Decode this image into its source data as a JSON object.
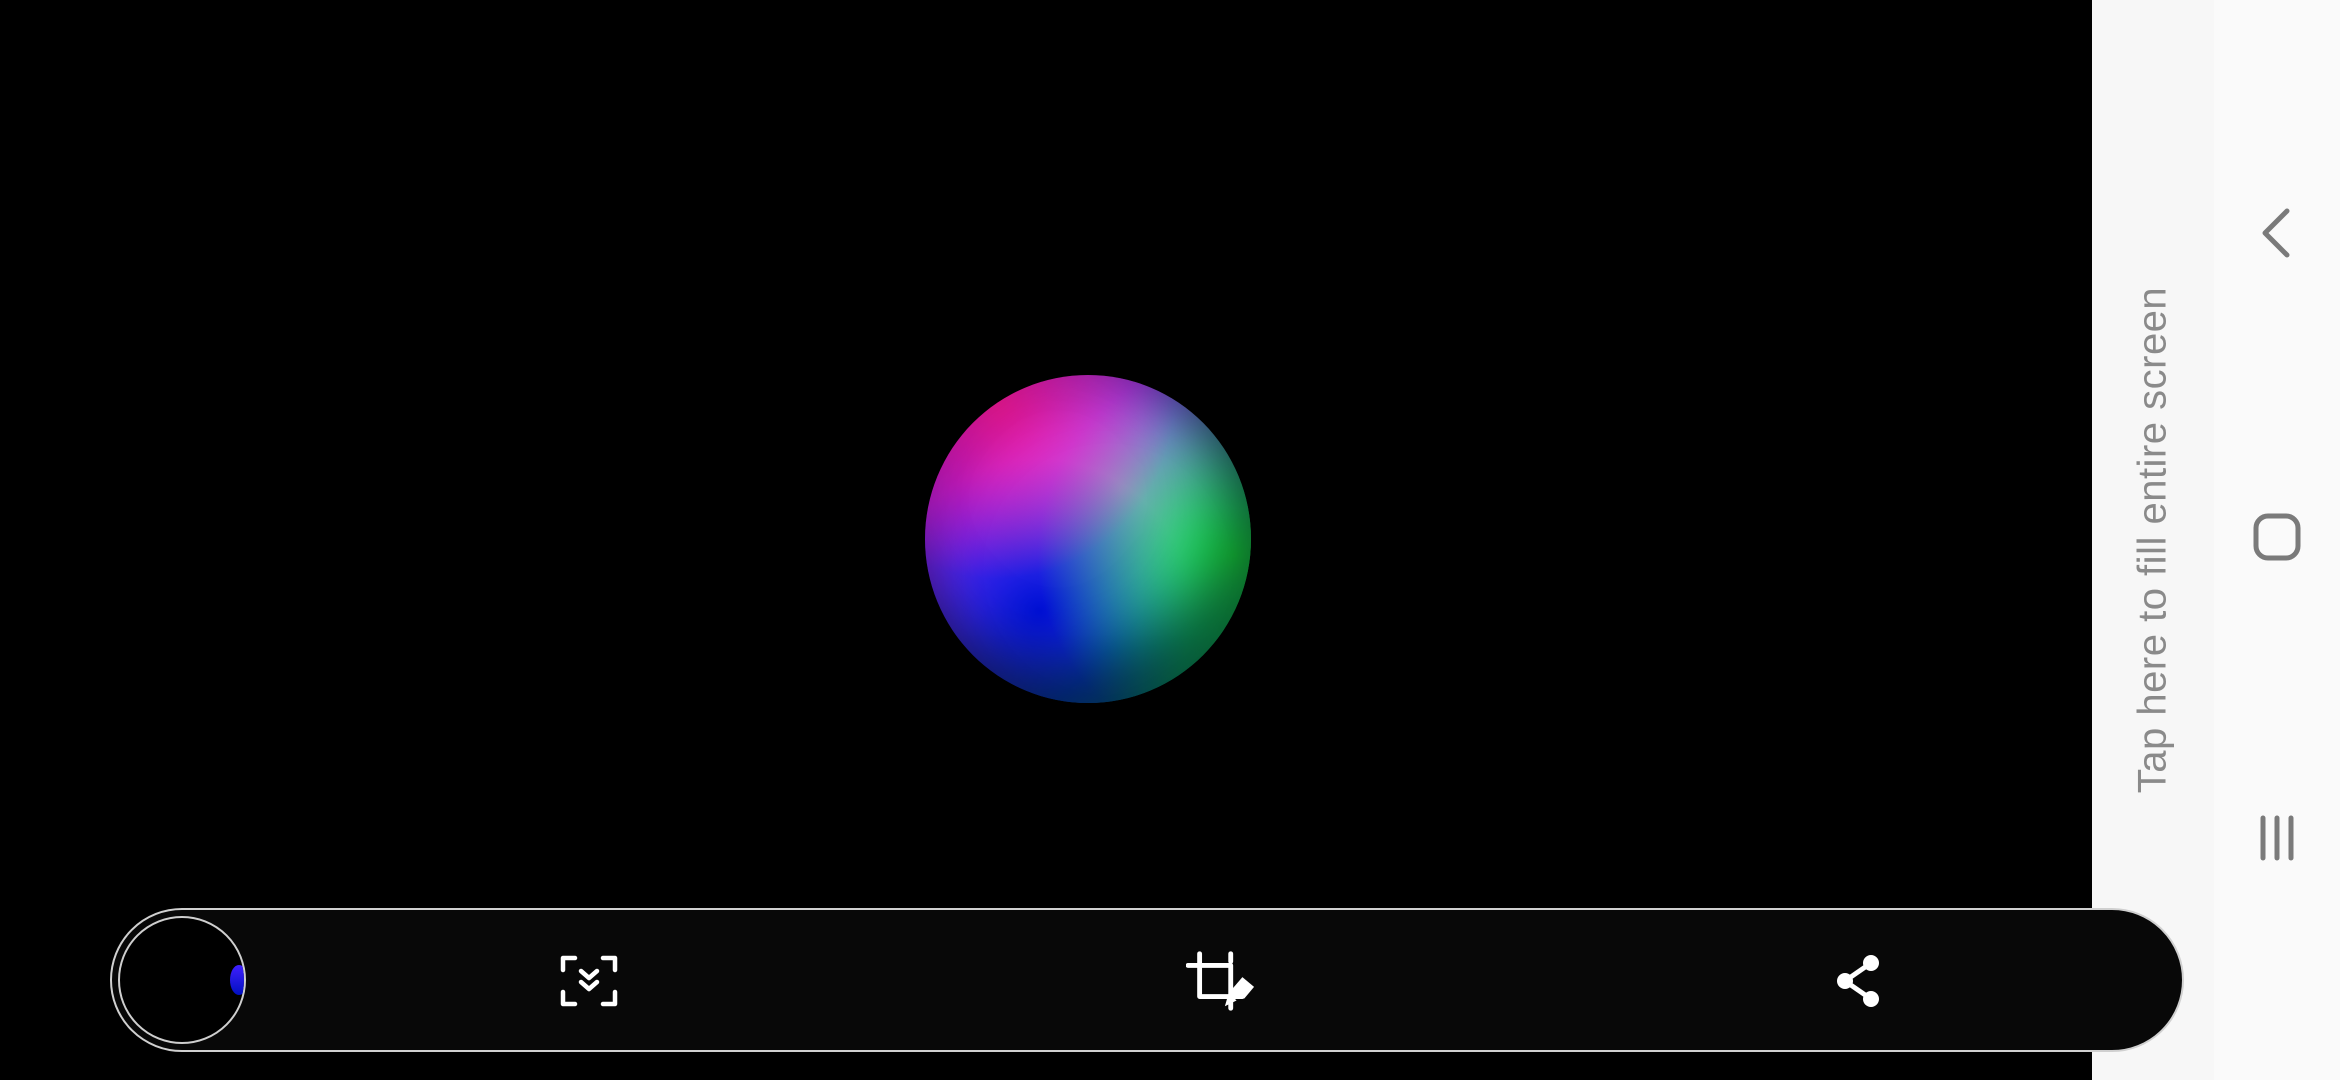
{
  "fill_screen": {
    "label": "Tap here to fill entire screen"
  },
  "toolbar": {
    "scroll_capture_icon": "scroll-capture-icon",
    "crop_edit_icon": "crop-edit-icon",
    "share_icon": "share-icon",
    "thumbnail": "screenshot-thumbnail"
  },
  "navigation": {
    "back_icon": "back-chevron-icon",
    "home_icon": "home-icon",
    "recents_icon": "recents-icon"
  },
  "colors": {
    "app_background": "#000000",
    "strip_background": "#f7f7f7",
    "nav_background": "#fafafa",
    "toolbar_background": "#080808",
    "nav_icon": "#7a7a7a",
    "toolbar_icon": "#ffffff"
  }
}
